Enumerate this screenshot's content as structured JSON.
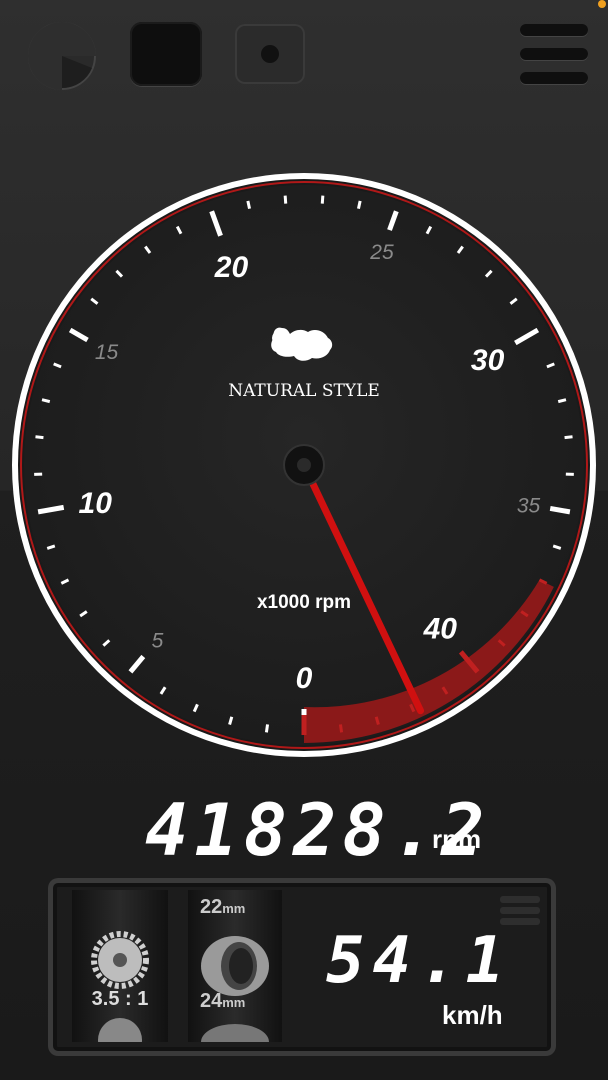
{
  "topbar": {
    "buttons": [
      {
        "name": "gauge-mode",
        "icon": "gauge-icon"
      },
      {
        "name": "dark-square",
        "icon": "square-icon"
      },
      {
        "name": "record",
        "icon": "record-icon"
      },
      {
        "name": "menu",
        "icon": "menu-icon"
      }
    ]
  },
  "gauge": {
    "brand": "NATURAL STYLE",
    "brand_icon": "monkey-logo",
    "unit_label": "x1000 rpm",
    "major_labels": [
      "0",
      "10",
      "20",
      "30",
      "40"
    ],
    "minor_labels": [
      "5",
      "15",
      "25",
      "35"
    ],
    "min": 0,
    "max": 45,
    "needle_value": 41.8282,
    "redline_start": 37,
    "colors": {
      "redline": "#b01818",
      "needle": "#d01010",
      "ring": "#ffffff"
    }
  },
  "readout": {
    "rpm_value": "41828.2",
    "rpm_unit": "rpm"
  },
  "panel": {
    "gear_ratio": "3.5 : 1",
    "tire_top": "22",
    "tire_top_unit": "mm",
    "tire_bottom": "24",
    "tire_bottom_unit": "mm",
    "speed_value": "54.1",
    "speed_unit": "km/h"
  }
}
